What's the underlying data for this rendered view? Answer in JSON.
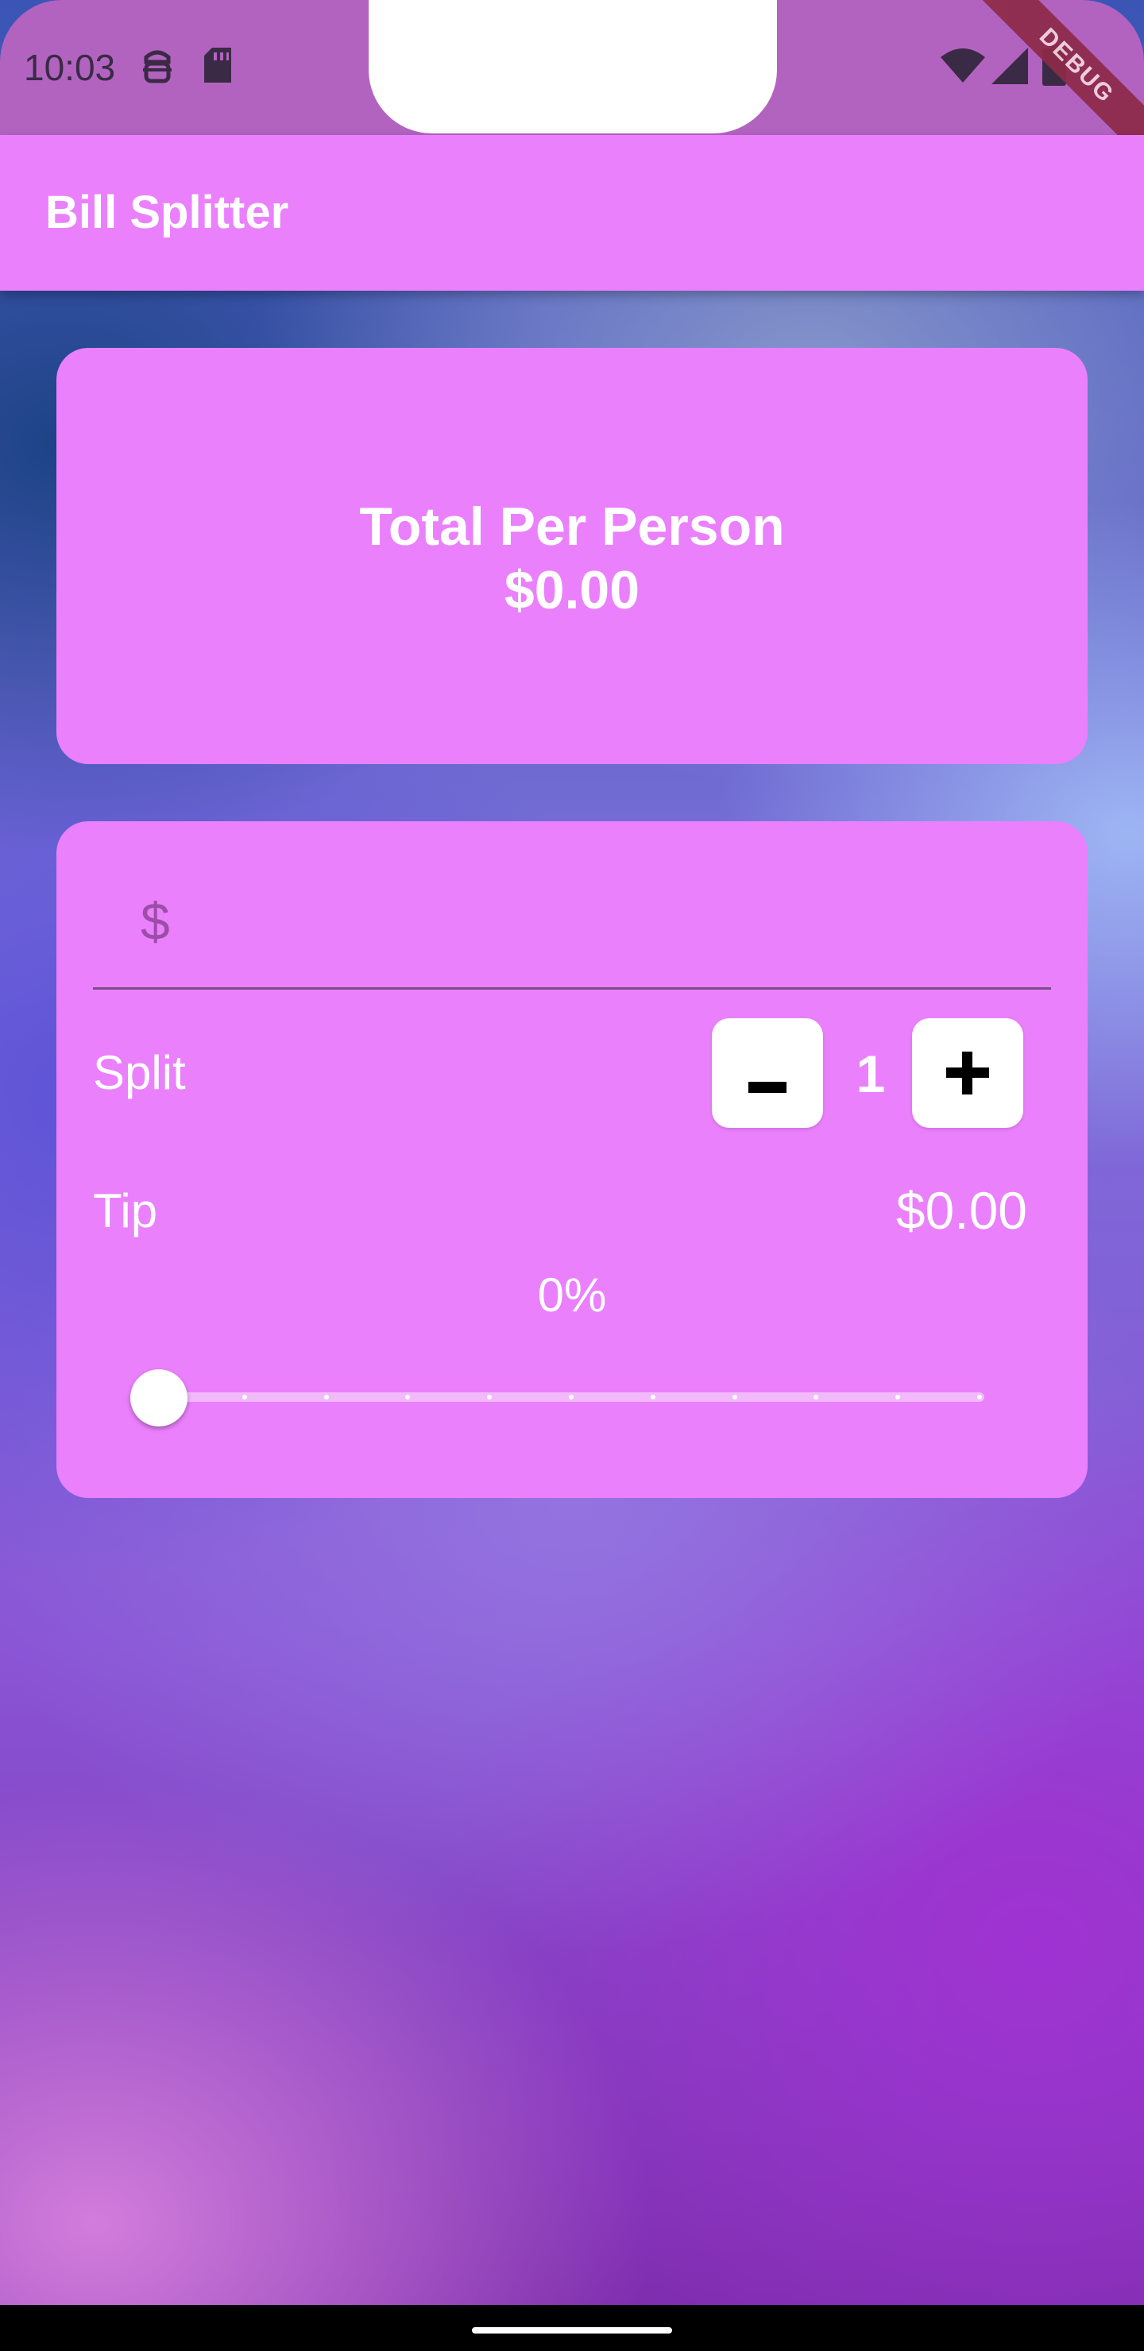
{
  "status_bar": {
    "time": "10:03",
    "icons": [
      "android-debug-icon",
      "sd-card-icon",
      "wifi-icon",
      "cell-signal-icon",
      "battery-icon"
    ],
    "debug_banner": "DEBUG"
  },
  "app_bar": {
    "title": "Bill Splitter"
  },
  "total_card": {
    "title": "Total Per Person",
    "amount": "$0.00"
  },
  "input_card": {
    "bill_input": {
      "prefix": "$",
      "value": "",
      "placeholder": ""
    },
    "split": {
      "label": "Split",
      "count": "1",
      "decrement_label": "-",
      "increment_label": "+"
    },
    "tip": {
      "label": "Tip",
      "amount": "$0.00",
      "percent": "0%",
      "slider_value": 0,
      "slider_min": 0,
      "slider_max": 100,
      "slider_divisions": 10
    }
  },
  "colors": {
    "primary": "#ea80fc",
    "status_bar": "#b263c0",
    "text_on_primary": "#ffffff"
  }
}
